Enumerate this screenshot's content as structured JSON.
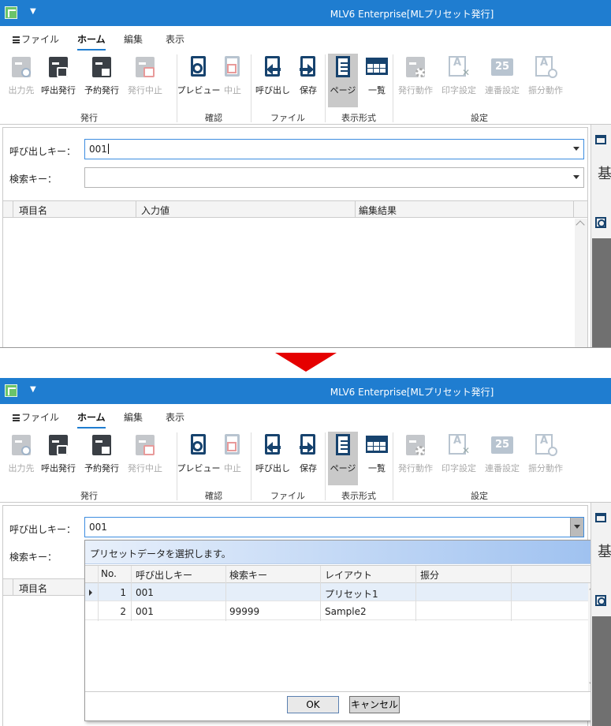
{
  "titlebar": {
    "title": "MLV6 Enterprise[MLプリセット発行]",
    "quick_access": "▼"
  },
  "menu_tabs": [
    "ファイル",
    "ホーム",
    "編集",
    "表示"
  ],
  "ribbon": {
    "groups": [
      "発行",
      "確認",
      "ファイル",
      "表示形式",
      "設定"
    ],
    "buttons": [
      "出力先",
      "呼出発行",
      "予約発行",
      "発行中止",
      "プレビュー",
      "中止",
      "呼び出し",
      "保存",
      "ページ",
      "一覧",
      "発行動作",
      "印字設定",
      "連番設定",
      "振分動作"
    ],
    "counter_icon_text": "25",
    "text_icon_glyph": "A"
  },
  "form": {
    "call_key_label": "呼び出しキー：",
    "call_key_value": "001",
    "search_key_label": "検索キー：",
    "search_key_value": ""
  },
  "grid": {
    "columns": [
      "項目名",
      "入力値",
      "編集結果"
    ]
  },
  "right_panel": {
    "char": "基"
  },
  "popup": {
    "header": "プリセットデータを選択します。",
    "columns": [
      "No.",
      "呼び出しキー",
      "検索キー",
      "レイアウト",
      "振分"
    ],
    "rows": [
      {
        "no": "1",
        "call_key": "001",
        "search_key": "",
        "layout": "プリセット1",
        "sort": ""
      },
      {
        "no": "2",
        "call_key": "001",
        "search_key": "99999",
        "layout": "Sample2",
        "sort": ""
      }
    ],
    "ok": "OK",
    "cancel": "キャンセル"
  },
  "colors": {
    "accent": "#1f7dd0",
    "arrow": "#e50000",
    "selected_row": "#e5eef9"
  }
}
